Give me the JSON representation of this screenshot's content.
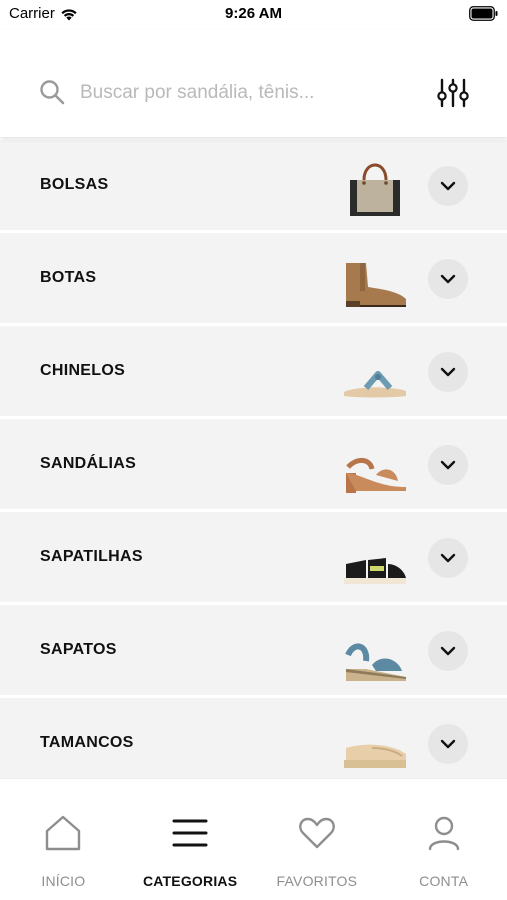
{
  "status_bar": {
    "carrier": "Carrier",
    "time": "9:26 AM"
  },
  "search": {
    "placeholder": "Buscar por sandália, tênis...",
    "value": ""
  },
  "icons": {
    "search": "search-icon",
    "filter": "sliders-icon",
    "expand": "chevron-down-icon"
  },
  "categories": [
    {
      "label": "BOLSAS",
      "thumb": "handbag"
    },
    {
      "label": "BOTAS",
      "thumb": "ankle-boot"
    },
    {
      "label": "CHINELOS",
      "thumb": "flip-flop"
    },
    {
      "label": "SANDÁLIAS",
      "thumb": "block-heel-sandal"
    },
    {
      "label": "SAPATILHAS",
      "thumb": "sneaker-sandal"
    },
    {
      "label": "SAPATOS",
      "thumb": "wedge-sandal"
    },
    {
      "label": "TAMANCOS",
      "thumb": "clog"
    }
  ],
  "tabs": [
    {
      "label": "INÍCIO",
      "icon": "home-icon",
      "active": false
    },
    {
      "label": "CATEGORIAS",
      "icon": "list-icon",
      "active": true
    },
    {
      "label": "FAVORITOS",
      "icon": "heart-icon",
      "active": false
    },
    {
      "label": "CONTA",
      "icon": "user-icon",
      "active": false
    }
  ],
  "colors": {
    "row_bg": "#f3f3f3",
    "chevron_bg": "#e6e6e6",
    "active_tab": "#111111",
    "inactive_tab": "#8e8e8e"
  }
}
